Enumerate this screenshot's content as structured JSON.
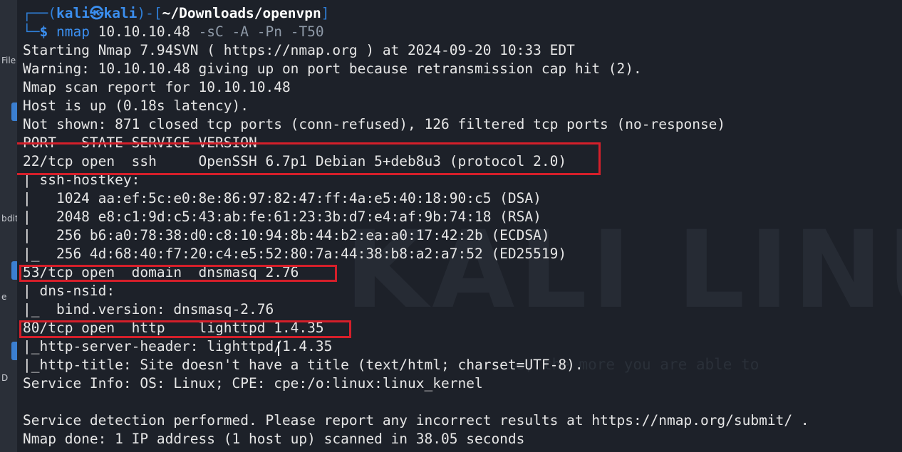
{
  "desktop": {
    "labels": [
      "File",
      "b",
      "dit",
      "l",
      "e",
      "D"
    ]
  },
  "terminal": {
    "top_fragment": "…",
    "prompt": {
      "frame_open": "┌──(",
      "user": "kali",
      "at": "㉿",
      "host": "kali",
      "frame_mid": ")-[",
      "path": "~/Downloads/openvpn",
      "frame_close": "]",
      "frame_corner": "└─",
      "symbol": "$ ",
      "command": "nmap",
      "args": " 10.10.10.48 ",
      "flags": "-sC -A -Pn -T50"
    },
    "output": [
      "Starting Nmap 7.94SVN ( https://nmap.org ) at 2024-09-20 10:33 EDT",
      "Warning: 10.10.10.48 giving up on port because retransmission cap hit (2).",
      "Nmap scan report for 10.10.10.48",
      "Host is up (0.18s latency).",
      "Not shown: 871 closed tcp ports (conn-refused), 126 filtered tcp ports (no-response)",
      "PORT   STATE SERVICE VERSION",
      "22/tcp open  ssh     OpenSSH 6.7p1 Debian 5+deb8u3 (protocol 2.0)",
      "| ssh-hostkey: ",
      "|   1024 aa:ef:5c:e0:8e:86:97:82:47:ff:4a:e5:40:18:90:c5 (DSA)",
      "|   2048 e8:c1:9d:c5:43:ab:fe:61:23:3b:d7:e4:af:9b:74:18 (RSA)",
      "|   256 b6:a0:78:38:d0:c8:10:94:8b:44:b2:ea:a0:17:42:2b (ECDSA)",
      "|_  256 4d:68:40:f7:20:c4:e5:52:80:7a:44:38:b8:a2:a7:52 (ED25519)",
      "53/tcp open  domain  dnsmasq 2.76",
      "| dns-nsid: ",
      "|_  bind.version: dnsmasq-2.76",
      "80/tcp open  http    lighttpd 1.4.35",
      "|_http-server-header: lighttpd/1.4.35",
      "|_http-title: Site doesn't have a title (text/html; charset=UTF-8).",
      "Service Info: OS: Linux; CPE: cpe:/o:linux:linux_kernel",
      "",
      "Service detection performed. Please report any incorrect results at https://nmap.org/submit/ .",
      "Nmap done: 1 IP address (1 host up) scanned in 38.05 seconds"
    ]
  },
  "watermark": {
    "logo_text": "KALI LINU",
    "tagline": "e, the more you are able to"
  },
  "colors": {
    "terminal_bg": "#1d2129",
    "prompt_blue": "#3b8ff0",
    "highlight_red": "#d51f2a",
    "text": "#e6e6e6"
  }
}
